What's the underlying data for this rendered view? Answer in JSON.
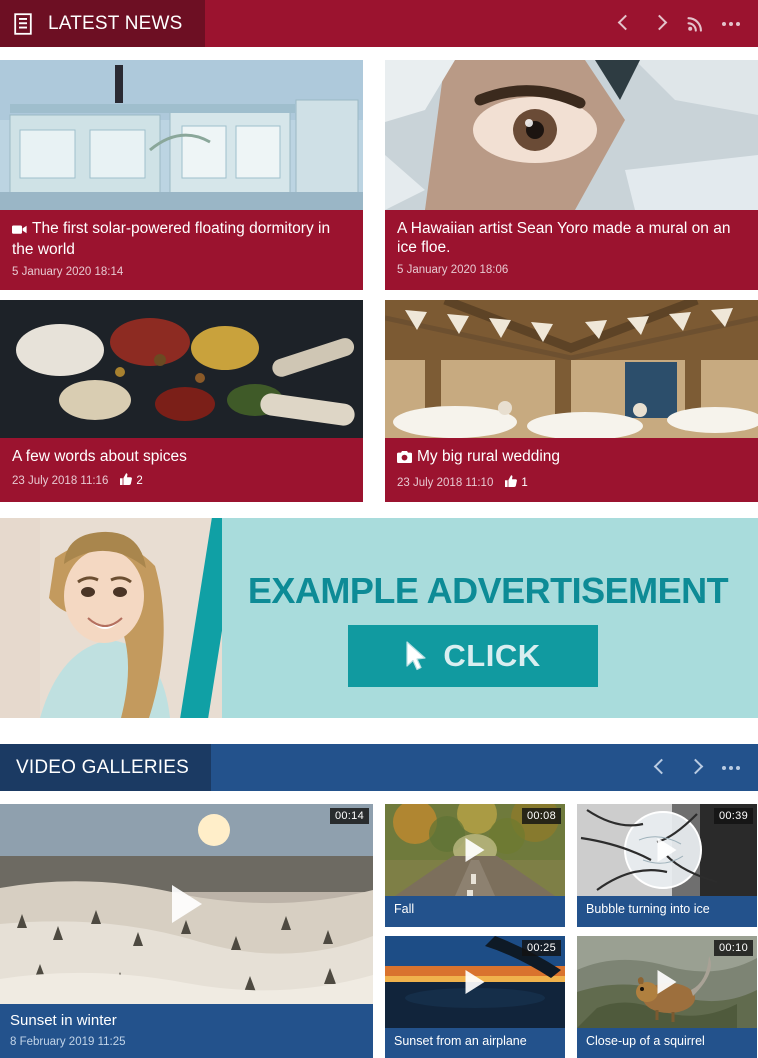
{
  "news_section": {
    "title": "LATEST NEWS",
    "icon": "article-list-icon",
    "accent_color": "#9b132f",
    "header_dark_color": "#6d0f23",
    "tools": {
      "prev": "chevron-left-icon",
      "next": "chevron-right-icon",
      "rss": "rss-icon",
      "more": "more-options-icon"
    },
    "cards": [
      {
        "title": "The first solar-powered floating dormitory in the world",
        "date": "5 January 2020 18:14",
        "media_icon": "video-camera-icon",
        "likes": "",
        "thumb": "shipping-container-floating-dormitory"
      },
      {
        "title": "A Hawaiian artist Sean Yoro made a mural on an ice floe.",
        "date": "5 January 2020 18:06",
        "media_icon": "",
        "likes": "",
        "thumb": "mural-eye-painted-on-ice-floe"
      },
      {
        "title": "A few words about spices",
        "date": "23 July 2018 11:16",
        "media_icon": "",
        "likes": "2",
        "thumb": "spices-in-spoons-on-dark-table"
      },
      {
        "title": "My big rural wedding",
        "date": "23 July 2018 11:10",
        "media_icon": "camera-icon",
        "likes": "1",
        "thumb": "rustic-barn-wedding-reception"
      }
    ]
  },
  "advertisement": {
    "headline": "EXAMPLE ADVERTISEMENT",
    "button_label": "CLICK",
    "button_icon": "mouse-cursor-icon",
    "background_color": "#a9dcdc",
    "accent_color": "#10a0a5",
    "photo_alt": "smiling-blonde-woman"
  },
  "video_section": {
    "title": "VIDEO GALLERIES",
    "accent_color": "#23528c",
    "header_dark_color": "#1b3a63",
    "tools": {
      "prev": "chevron-left-icon",
      "next": "chevron-right-icon",
      "more": "more-options-icon"
    },
    "featured": {
      "title": "Sunset in winter",
      "date": "8 February 2019 11:25",
      "duration": "00:14",
      "thumb": "aerial-snowy-forest-at-sunset"
    },
    "items": [
      {
        "title": "Fall",
        "duration": "00:08",
        "thumb": "autumn-road-through-forest"
      },
      {
        "title": "Bubble turning into ice",
        "duration": "00:39",
        "thumb": "freezing-soap-bubble"
      },
      {
        "title": "Sunset from an airplane",
        "duration": "00:25",
        "thumb": "sunset-seen-from-plane-window"
      },
      {
        "title": "Close-up of a squirrel",
        "duration": "00:10",
        "thumb": "squirrel-on-rocks"
      }
    ]
  }
}
